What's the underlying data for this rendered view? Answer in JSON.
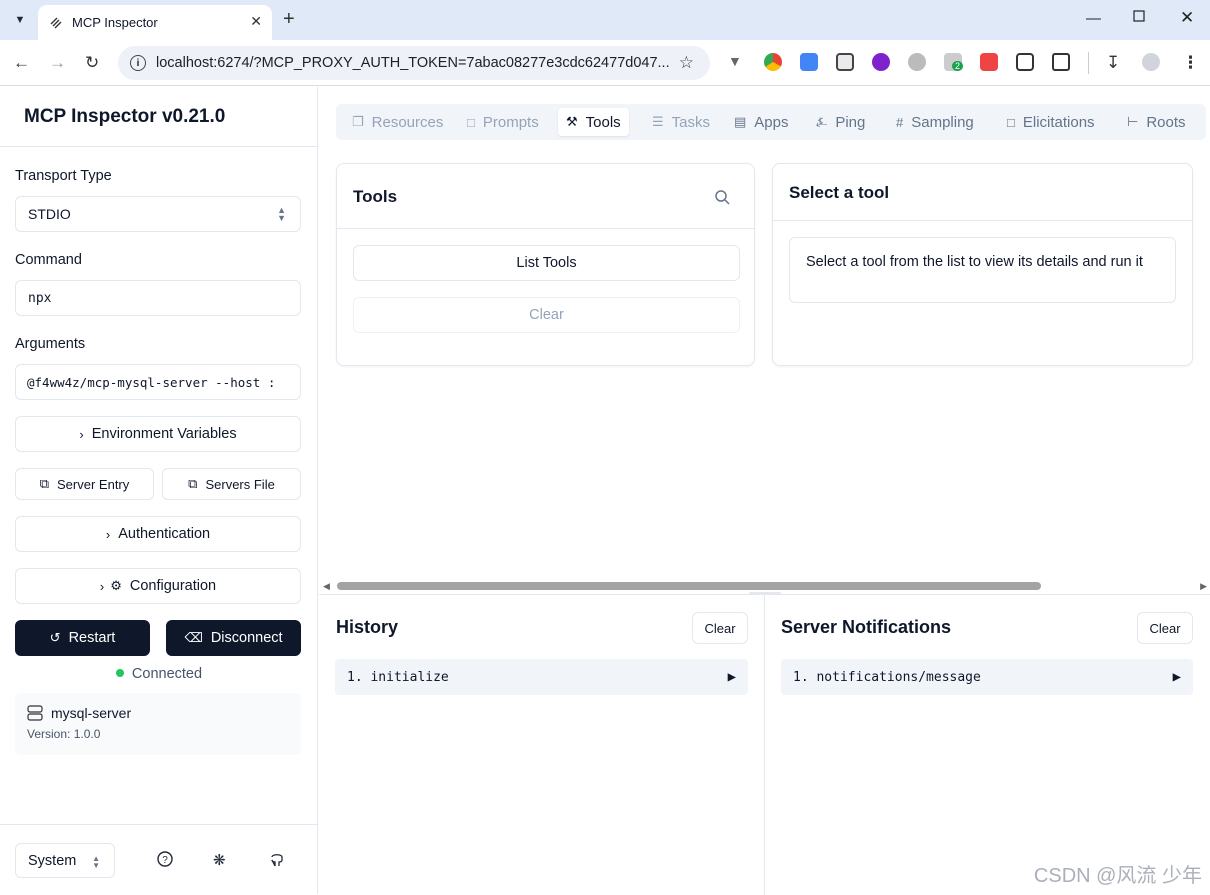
{
  "browser": {
    "tab_title": "MCP Inspector",
    "url": "localhost:6274/?MCP_PROXY_AUTH_TOKEN=7abac08277e3cdc62477d047...",
    "extension_badge": "2"
  },
  "sidebar": {
    "title": "MCP Inspector v0.21.0",
    "transport_label": "Transport Type",
    "transport_value": "STDIO",
    "command_label": "Command",
    "command_value": "npx",
    "arguments_label": "Arguments",
    "arguments_value": "@f4ww4z/mcp-mysql-server --host :",
    "env_button": "Environment Variables",
    "server_entry_button": "Server Entry",
    "servers_file_button": "Servers File",
    "auth_button": "Authentication",
    "config_button": "Configuration",
    "restart_button": "Restart",
    "disconnect_button": "Disconnect",
    "status": "Connected",
    "server_name": "mysql-server",
    "server_version": "Version: 1.0.0",
    "theme_value": "System"
  },
  "tabs": [
    "Resources",
    "Prompts",
    "Tools",
    "Tasks",
    "Apps",
    "Ping",
    "Sampling",
    "Elicitations",
    "Roots"
  ],
  "tools_panel": {
    "title": "Tools",
    "list_button": "List Tools",
    "clear_button": "Clear"
  },
  "detail_panel": {
    "title": "Select a tool",
    "message": "Select a tool from the list to view its details and run it"
  },
  "history": {
    "title": "History",
    "clear": "Clear",
    "entries": [
      "1. initialize"
    ]
  },
  "notifications": {
    "title": "Server Notifications",
    "clear": "Clear",
    "entries": [
      "1. notifications/message"
    ]
  },
  "watermark": "CSDN @风流 少年"
}
